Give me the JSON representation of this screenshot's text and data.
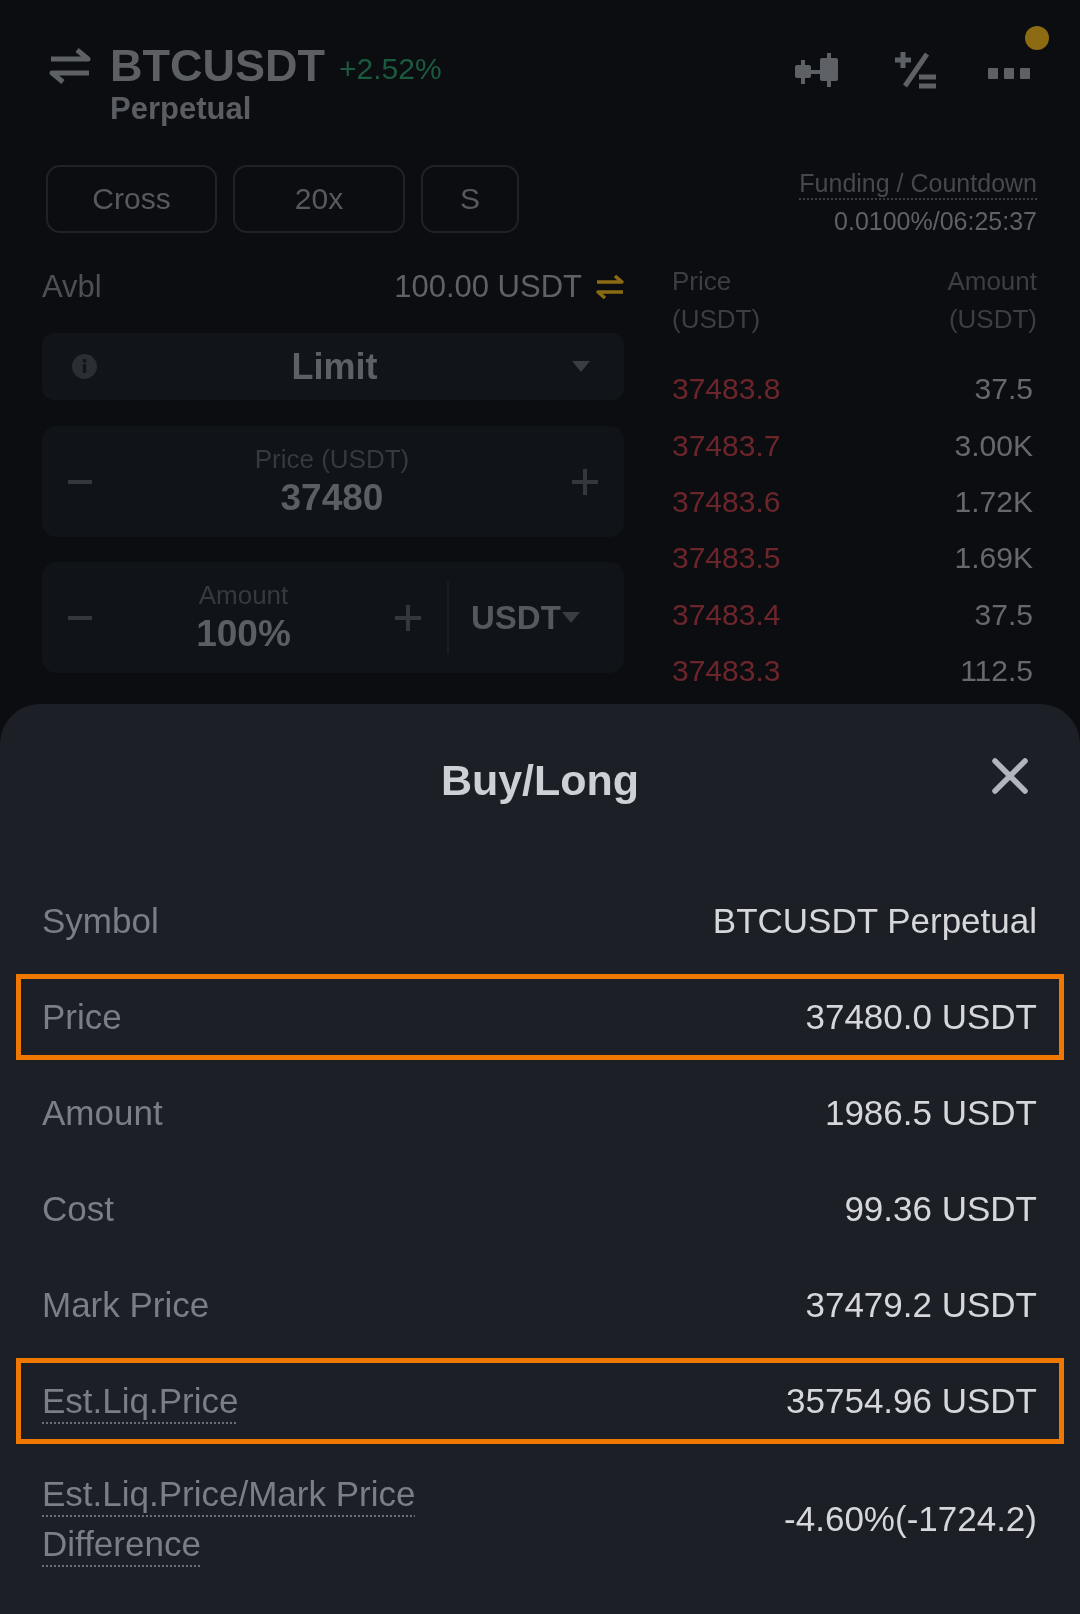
{
  "header": {
    "symbol": "BTCUSDT",
    "change": "+2.52%",
    "contract": "Perpetual",
    "menu_badge": true
  },
  "margin_buttons": [
    {
      "label": "Cross"
    },
    {
      "label": "20x"
    },
    {
      "label": "S"
    }
  ],
  "funding": {
    "label": "Funding / Countdown",
    "value": "0.0100%/06:25:37"
  },
  "available": {
    "label": "Avbl",
    "value": "100.00 USDT"
  },
  "order_type": {
    "value": "Limit"
  },
  "price_field": {
    "label": "Price (USDT)",
    "value": "37480"
  },
  "amount_field": {
    "label": "Amount",
    "value": "100%",
    "unit": "USDT"
  },
  "order_book": {
    "columns": [
      "Price (USDT)",
      "Amount (USDT)"
    ],
    "rows": [
      {
        "price": "37483.8",
        "amount": "37.5"
      },
      {
        "price": "37483.7",
        "amount": "3.00K"
      },
      {
        "price": "37483.6",
        "amount": "1.72K"
      },
      {
        "price": "37483.5",
        "amount": "1.69K"
      },
      {
        "price": "37483.4",
        "amount": "37.5"
      },
      {
        "price": "37483.3",
        "amount": "112.5"
      }
    ]
  },
  "dialog": {
    "title": "Buy/Long",
    "rows": [
      {
        "label": "Symbol",
        "value": "BTCUSDT Perpetual",
        "has_tooltip": false,
        "highlighted": false
      },
      {
        "label": "Price",
        "value": "37480.0 USDT",
        "has_tooltip": false,
        "highlighted": true
      },
      {
        "label": "Amount",
        "value": "1986.5 USDT",
        "has_tooltip": false,
        "highlighted": false
      },
      {
        "label": "Cost",
        "value": "99.36 USDT",
        "has_tooltip": false,
        "highlighted": false
      },
      {
        "label": "Mark Price",
        "value": "37479.2 USDT",
        "has_tooltip": false,
        "highlighted": false
      },
      {
        "label": "Est.Liq.Price",
        "value": "35754.96 USDT",
        "has_tooltip": true,
        "highlighted": true
      },
      {
        "label": "Est.Liq.Price/Mark Price Difference",
        "value": "-4.60%(-1724.2)",
        "has_tooltip": true,
        "highlighted": false
      }
    ]
  }
}
